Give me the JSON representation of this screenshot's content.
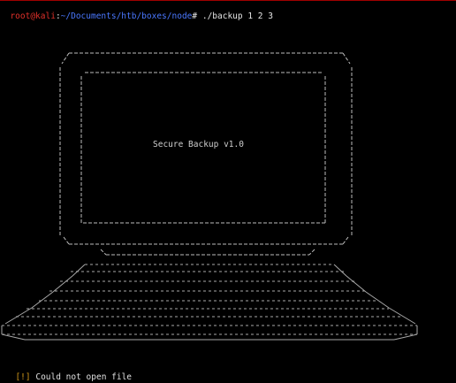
{
  "terminal": {
    "prompt_user_host": "root@kali",
    "prompt_sep": ":",
    "prompt_path": "~/Documents/htb/boxes/node",
    "prompt_symbol": "# ",
    "command": "./backup 1 2 3",
    "screen_title": "Secure Backup v1.0",
    "status_marker": "[!]",
    "status_message": " Could not open file"
  },
  "colors": {
    "prompt_user": "#e0302a",
    "prompt_path": "#4a78ff",
    "warning": "#d49a1a",
    "background": "#000000",
    "art": "#bdbdbd"
  }
}
